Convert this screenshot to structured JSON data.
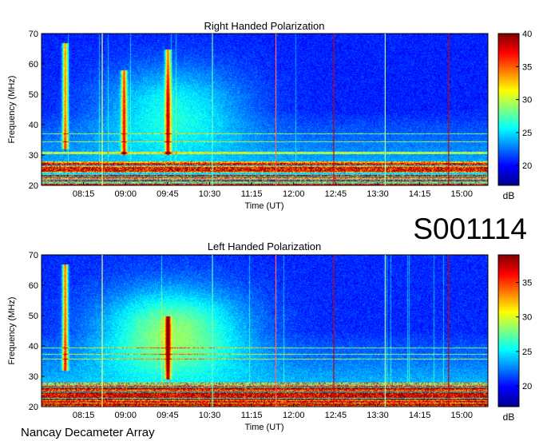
{
  "observation_id": "S001114",
  "footer_text": "Nancay Decameter Array",
  "colors": {
    "colormap": [
      "#00008f",
      "#0000ff",
      "#0080ff",
      "#00ffff",
      "#80ff80",
      "#ffff00",
      "#ff8000",
      "#ff0000",
      "#800000"
    ]
  },
  "chart_data": [
    {
      "type": "heatmap",
      "title": "Right Handed Polarization",
      "xlabel": "Time (UT)",
      "ylabel": "Frequency (MHz)",
      "x_tick_labels": [
        "08:15",
        "09:00",
        "09:45",
        "10:30",
        "11:15",
        "12:00",
        "12:45",
        "13:30",
        "14:15",
        "15:00"
      ],
      "y_ticks": [
        20,
        30,
        40,
        50,
        60,
        70
      ],
      "ylim": [
        20,
        70
      ],
      "colorbar": {
        "ticks": [
          20,
          25,
          30,
          35,
          40
        ],
        "range": [
          17,
          40
        ],
        "label": "dB"
      },
      "vertical_lines": [
        {
          "time": "08:35",
          "color": "#ffff66"
        },
        {
          "time": "10:33",
          "color": "#66ffcc"
        },
        {
          "time": "11:41",
          "color": "#ff6666"
        },
        {
          "time": "12:43",
          "color": "#cc0000"
        },
        {
          "time": "13:38",
          "color": "#aaffaa"
        },
        {
          "time": "14:46",
          "color": "#cc0000"
        }
      ],
      "features": {
        "interference_band_mhz": [
          20,
          28
        ],
        "bursts": [
          {
            "time": "07:55",
            "fmin": 32,
            "fmax": 67
          },
          {
            "time": "08:58",
            "fmin": 30,
            "fmax": 58
          },
          {
            "time": "09:45",
            "fmin": 30,
            "fmax": 65
          }
        ]
      }
    },
    {
      "type": "heatmap",
      "title": "Left Handed Polarization",
      "xlabel": "Time (UT)",
      "ylabel": "Frequency (MHz)",
      "x_tick_labels": [
        "08:15",
        "09:00",
        "09:45",
        "10:30",
        "11:15",
        "12:00",
        "12:45",
        "13:30",
        "14:15",
        "15:00"
      ],
      "y_ticks": [
        20,
        30,
        40,
        50,
        60,
        70
      ],
      "ylim": [
        20,
        70
      ],
      "colorbar": {
        "ticks": [
          20,
          25,
          30,
          35
        ],
        "range": [
          17,
          39
        ],
        "label": "dB"
      },
      "vertical_lines": [
        {
          "time": "08:35",
          "color": "#ffff66"
        },
        {
          "time": "10:33",
          "color": "#66ffcc"
        },
        {
          "time": "11:41",
          "color": "#ff6666"
        },
        {
          "time": "12:43",
          "color": "#cc0000"
        },
        {
          "time": "13:38",
          "color": "#aaffaa"
        },
        {
          "time": "14:46",
          "color": "#cc0000"
        }
      ],
      "features": {
        "interference_band_mhz": [
          20,
          28
        ],
        "bursts": [
          {
            "time": "07:55",
            "fmin": 32,
            "fmax": 67
          },
          {
            "time": "09:45",
            "fmin": 29,
            "fmax": 50
          }
        ]
      }
    }
  ]
}
